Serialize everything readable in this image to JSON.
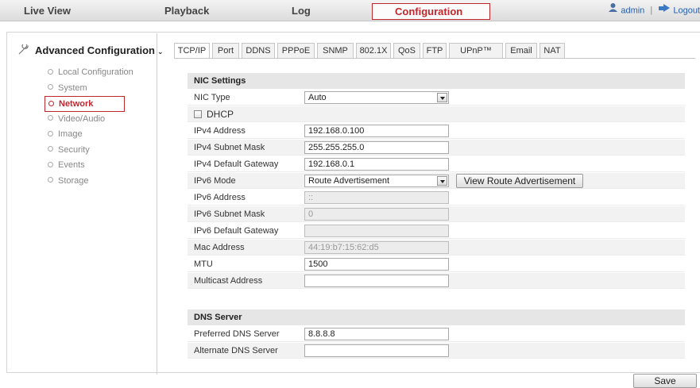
{
  "topnav": {
    "tabs": [
      "Live View",
      "Playback",
      "Log",
      "Configuration"
    ],
    "active_tab": "Configuration",
    "user_label": "admin",
    "logout_label": "Logout"
  },
  "sidebar": {
    "title": "Advanced Configuration",
    "items": [
      {
        "label": "Local Configuration"
      },
      {
        "label": "System"
      },
      {
        "label": "Network"
      },
      {
        "label": "Video/Audio"
      },
      {
        "label": "Image"
      },
      {
        "label": "Security"
      },
      {
        "label": "Events"
      },
      {
        "label": "Storage"
      }
    ],
    "active_item": "Network"
  },
  "subtabs": [
    "TCP/IP",
    "Port",
    "DDNS",
    "PPPoE",
    "SNMP",
    "802.1X",
    "QoS",
    "FTP",
    "UPnP™",
    "Email",
    "NAT"
  ],
  "active_subtab": "TCP/IP",
  "nic": {
    "heading": "NIC Settings",
    "nic_type_label": "NIC Type",
    "nic_type_value": "Auto",
    "dhcp_label": "DHCP",
    "ipv4_address_label": "IPv4 Address",
    "ipv4_address_value": "192.168.0.100",
    "ipv4_mask_label": "IPv4 Subnet Mask",
    "ipv4_mask_value": "255.255.255.0",
    "ipv4_gw_label": "IPv4 Default Gateway",
    "ipv4_gw_value": "192.168.0.1",
    "ipv6_mode_label": "IPv6 Mode",
    "ipv6_mode_value": "Route Advertisement",
    "view_route_label": "View Route Advertisement",
    "ipv6_address_label": "IPv6 Address",
    "ipv6_address_value": "::",
    "ipv6_mask_label": "IPv6 Subnet Mask",
    "ipv6_mask_value": "0",
    "ipv6_gw_label": "IPv6 Default Gateway",
    "ipv6_gw_value": "",
    "mac_label": "Mac Address",
    "mac_value": "44:19:b7:15:62:d5",
    "mtu_label": "MTU",
    "mtu_value": "1500",
    "multicast_label": "Multicast Address",
    "multicast_value": ""
  },
  "dns": {
    "heading": "DNS Server",
    "preferred_label": "Preferred DNS Server",
    "preferred_value": "8.8.8.8",
    "alternate_label": "Alternate DNS Server",
    "alternate_value": ""
  },
  "save_label": "Save",
  "colors": {
    "accent": "#c0272d",
    "link": "#2a5ea8",
    "section_bg": "#e6e6e6"
  }
}
